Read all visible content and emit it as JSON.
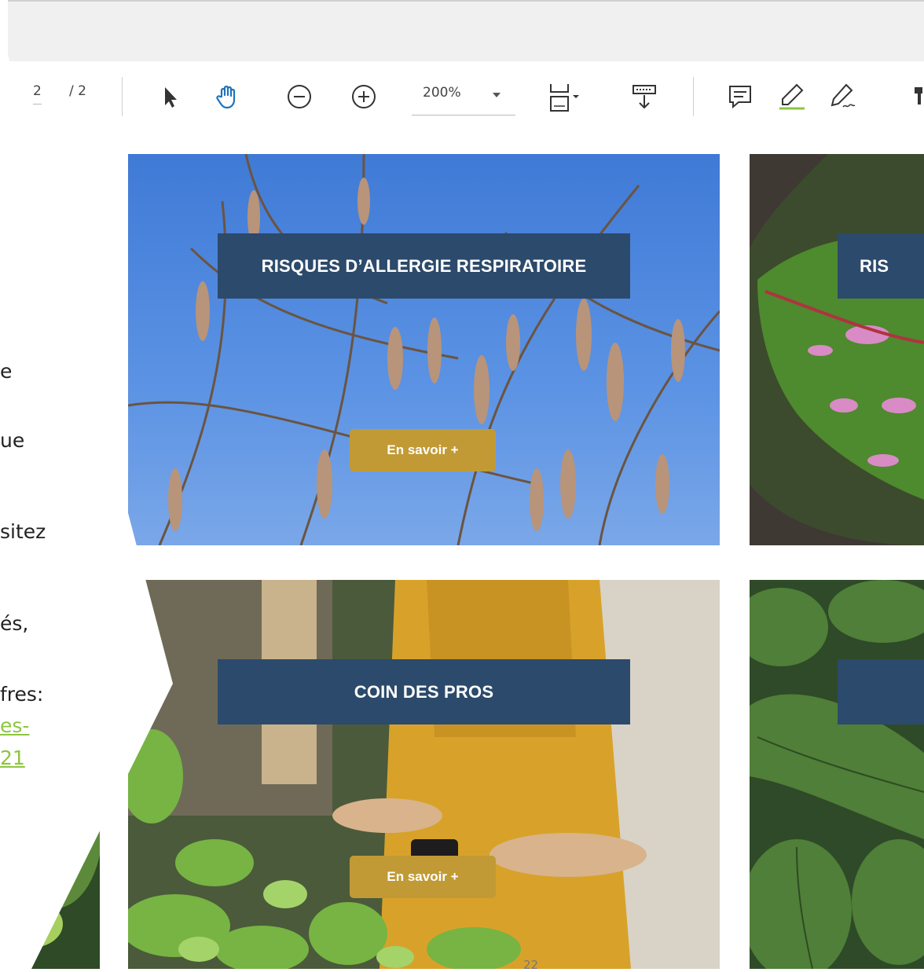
{
  "toolbar": {
    "page_current": "2",
    "page_total": "/ 2",
    "zoom_value": "200%",
    "icons": [
      "select-arrow-icon",
      "hand-pan-icon",
      "zoom-out-icon",
      "zoom-in-icon",
      "page-fit-icon",
      "scroll-mode-icon",
      "comment-icon",
      "highlight-icon",
      "sign-icon",
      "stamp-icon"
    ]
  },
  "tiles": [
    {
      "label": "RISQUES D’ALLERGIE RESPIRATOIRE",
      "button": "En savoir +"
    },
    {
      "label": "RIS",
      "button": ""
    },
    {
      "label": "COIN DES PROS",
      "button": "En savoir +"
    },
    {
      "label": "",
      "button": ""
    }
  ],
  "slide": {
    "fragments": [
      "e",
      "ue",
      "sitez",
      "és,",
      "fres:"
    ],
    "link_fragments": [
      "es-",
      "21"
    ]
  },
  "footer": {
    "page_number": "22"
  },
  "colors": {
    "label_bg": "#2c4a6b",
    "button_bg": "#c19a35",
    "link": "#8dc63f"
  }
}
